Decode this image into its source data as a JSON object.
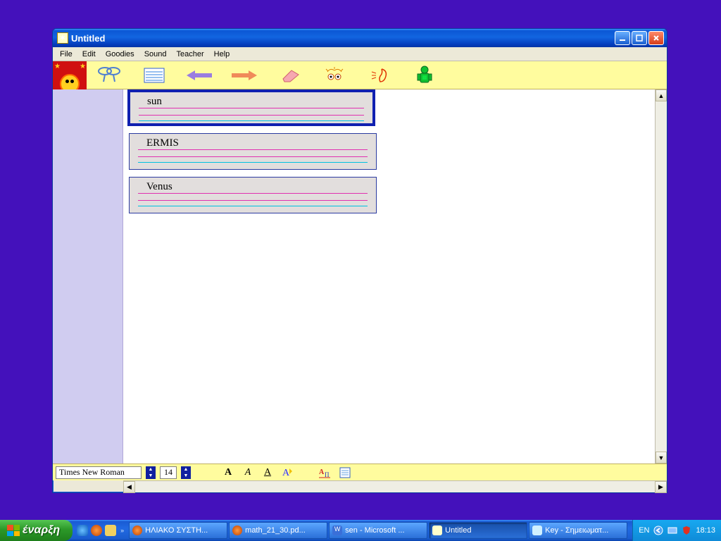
{
  "window": {
    "title": "Untitled"
  },
  "menu": {
    "file": "File",
    "edit": "Edit",
    "goodies": "Goodies",
    "sound": "Sound",
    "teacher": "Teacher",
    "help": "Help"
  },
  "cards": [
    {
      "text": "sun"
    },
    {
      "text": "ERMIS"
    },
    {
      "text": "Venus"
    }
  ],
  "status": {
    "font": "Times New Roman",
    "size": "14"
  },
  "taskbar": {
    "start": "έναρξη",
    "tasks": [
      {
        "label": "ΗΛΙΑΚΟ ΣΥΣΤΗ..."
      },
      {
        "label": "math_21_30.pd..."
      },
      {
        "label": "sen - Microsoft ..."
      },
      {
        "label": "Untitled",
        "active": true
      },
      {
        "label": "Key - Σημειωματ..."
      }
    ],
    "lang": "EN",
    "time": "18:13"
  }
}
